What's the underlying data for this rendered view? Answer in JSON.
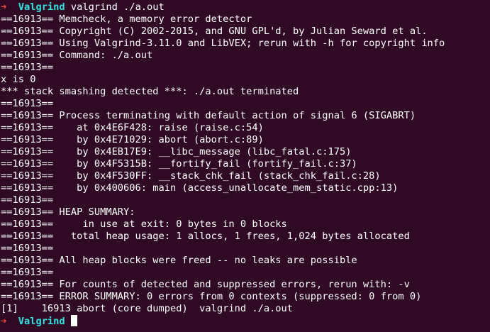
{
  "colors": {
    "background": "#300a24",
    "text": "#ffffff",
    "prompt_arrow": "#f24b3a",
    "prompt_dir": "#34e2e2"
  },
  "prompt": {
    "arrow": "➜",
    "directory": "Valgrind",
    "command": "valgrind ./a.out"
  },
  "output_lines": [
    "==16913== Memcheck, a memory error detector",
    "==16913== Copyright (C) 2002-2015, and GNU GPL'd, by Julian Seward et al.",
    "==16913== Using Valgrind-3.11.0 and LibVEX; rerun with -h for copyright info",
    "==16913== Command: ./a.out",
    "==16913==",
    "x is 0",
    "*** stack smashing detected ***: ./a.out terminated",
    "==16913==",
    "==16913== Process terminating with default action of signal 6 (SIGABRT)",
    "==16913==    at 0x4E6F428: raise (raise.c:54)",
    "==16913==    by 0x4E71029: abort (abort.c:89)",
    "==16913==    by 0x4EB17E9: __libc_message (libc_fatal.c:175)",
    "==16913==    by 0x4F5315B: __fortify_fail (fortify_fail.c:37)",
    "==16913==    by 0x4F530FF: __stack_chk_fail (stack_chk_fail.c:28)",
    "==16913==    by 0x400606: main (access_unallocate_mem_static.cpp:13)",
    "==16913==",
    "==16913== HEAP SUMMARY:",
    "==16913==     in use at exit: 0 bytes in 0 blocks",
    "==16913==   total heap usage: 1 allocs, 1 frees, 1,024 bytes allocated",
    "==16913==",
    "==16913== All heap blocks were freed -- no leaks are possible",
    "==16913==",
    "==16913== For counts of detected and suppressed errors, rerun with: -v",
    "==16913== ERROR SUMMARY: 0 errors from 0 contexts (suppressed: 0 from 0)",
    "[1]    16913 abort (core dumped)  valgrind ./a.out"
  ],
  "final_prompt": {
    "arrow": "➜",
    "directory": "Valgrind"
  }
}
